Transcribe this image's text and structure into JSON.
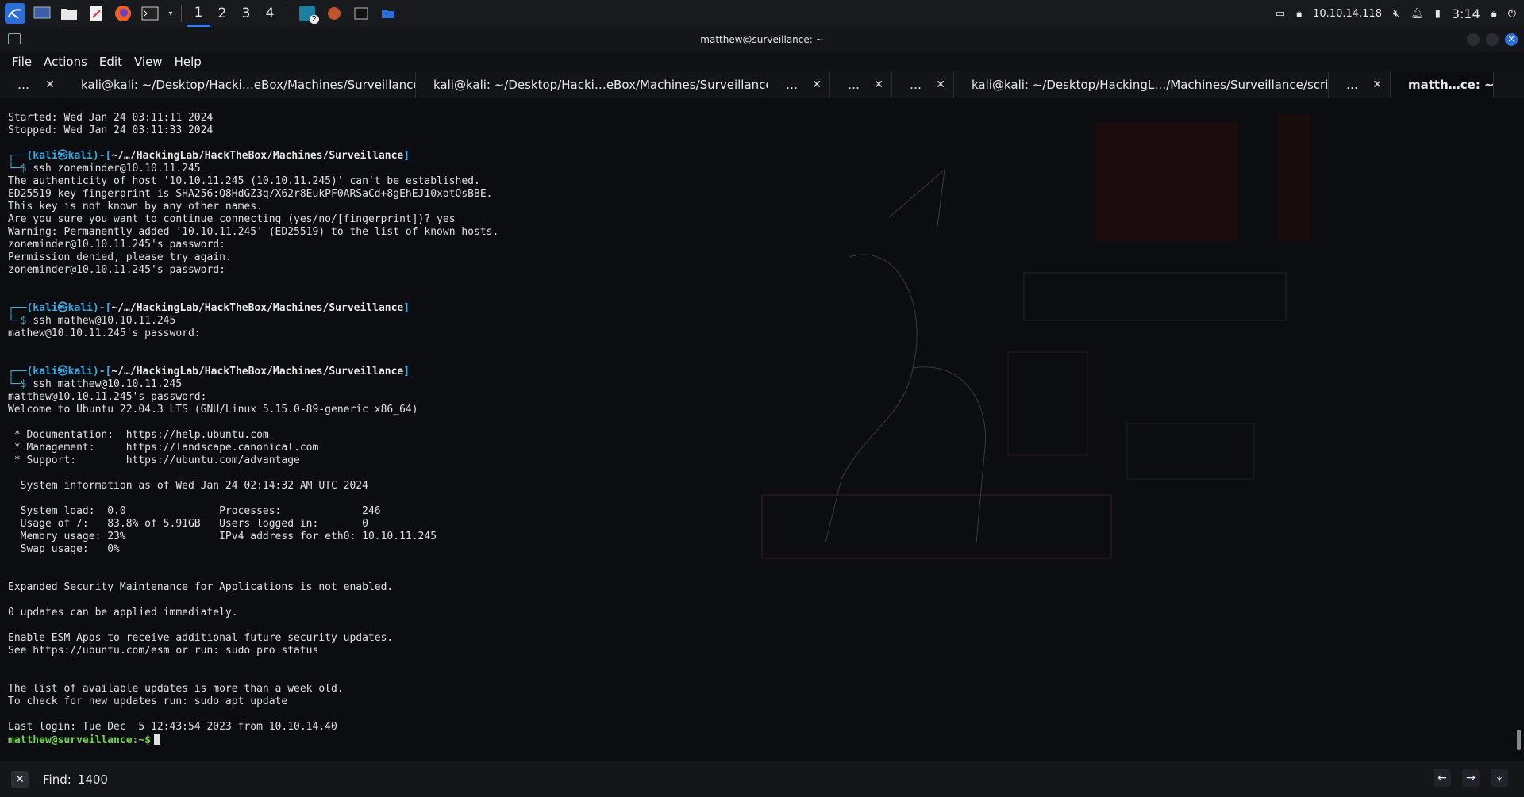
{
  "taskbar": {
    "workspaces": [
      "1",
      "2",
      "3",
      "4"
    ],
    "active_workspace": "1",
    "badge": "2",
    "tray": {
      "ip": "10.10.14.118",
      "time": "3:14"
    }
  },
  "window": {
    "title": "matthew@surveillance: ~"
  },
  "menu": [
    "File",
    "Actions",
    "Edit",
    "View",
    "Help"
  ],
  "tabs": [
    {
      "label": "…",
      "w": 80
    },
    {
      "label": "kali@kali: ~/Desktop/Hacki…eBox/Machines/Surveillance",
      "w": 444
    },
    {
      "label": "kali@kali: ~/Desktop/Hacki…eBox/Machines/Surveillance",
      "w": 444
    },
    {
      "label": "…",
      "w": 78
    },
    {
      "label": "…",
      "w": 78
    },
    {
      "label": "…",
      "w": 78
    },
    {
      "label": "kali@kali: ~/Desktop/HackingL…/Machines/Surveillance/script",
      "w": 472
    },
    {
      "label": "…",
      "w": 78
    },
    {
      "label": "matth…ce: ~",
      "w": 130,
      "active": true
    }
  ],
  "terminal": {
    "lines": [
      {
        "t": "Started: Wed Jan 24 03:11:11 2024"
      },
      {
        "t": "Stopped: Wed Jan 24 03:11:33 2024"
      },
      {
        "t": ""
      },
      {
        "k": "p1",
        "t": "┌──(kali㉿kali)-[",
        "path": "~/…/HackingLab/HackTheBox/Machines/Surveillance",
        "end": "]"
      },
      {
        "k": "p2",
        "t": "└─$ ",
        "cmd": "ssh zoneminder@10.10.11.245"
      },
      {
        "t": "The authenticity of host '10.10.11.245 (10.10.11.245)' can't be established."
      },
      {
        "t": "ED25519 key fingerprint is SHA256:Q8HdGZ3q/X62r8EukPF0ARSaCd+8gEhEJ10xotOsBBE."
      },
      {
        "t": "This key is not known by any other names."
      },
      {
        "t": "Are you sure you want to continue connecting (yes/no/[fingerprint])? yes"
      },
      {
        "t": "Warning: Permanently added '10.10.11.245' (ED25519) to the list of known hosts."
      },
      {
        "t": "zoneminder@10.10.11.245's password:"
      },
      {
        "t": "Permission denied, please try again."
      },
      {
        "t": "zoneminder@10.10.11.245's password:"
      },
      {
        "t": ""
      },
      {
        "t": ""
      },
      {
        "k": "p1",
        "t": "┌──(kali㉿kali)-[",
        "path": "~/…/HackingLab/HackTheBox/Machines/Surveillance",
        "end": "]"
      },
      {
        "k": "p2",
        "t": "└─$ ",
        "cmd": "ssh mathew@10.10.11.245"
      },
      {
        "t": "mathew@10.10.11.245's password:"
      },
      {
        "t": ""
      },
      {
        "t": ""
      },
      {
        "k": "p1",
        "t": "┌──(kali㉿kali)-[",
        "path": "~/…/HackingLab/HackTheBox/Machines/Surveillance",
        "end": "]"
      },
      {
        "k": "p2",
        "t": "└─$ ",
        "cmd": "ssh matthew@10.10.11.245"
      },
      {
        "t": "matthew@10.10.11.245's password:"
      },
      {
        "t": "Welcome to Ubuntu 22.04.3 LTS (GNU/Linux 5.15.0-89-generic x86_64)"
      },
      {
        "t": ""
      },
      {
        "t": " * Documentation:  https://help.ubuntu.com"
      },
      {
        "t": " * Management:     https://landscape.canonical.com"
      },
      {
        "t": " * Support:        https://ubuntu.com/advantage"
      },
      {
        "t": ""
      },
      {
        "t": "  System information as of Wed Jan 24 02:14:32 AM UTC 2024"
      },
      {
        "t": ""
      },
      {
        "t": "  System load:  0.0               Processes:             246"
      },
      {
        "t": "  Usage of /:   83.8% of 5.91GB   Users logged in:       0"
      },
      {
        "t": "  Memory usage: 23%               IPv4 address for eth0: 10.10.11.245"
      },
      {
        "t": "  Swap usage:   0%"
      },
      {
        "t": ""
      },
      {
        "t": ""
      },
      {
        "t": "Expanded Security Maintenance for Applications is not enabled."
      },
      {
        "t": ""
      },
      {
        "t": "0 updates can be applied immediately."
      },
      {
        "t": ""
      },
      {
        "t": "Enable ESM Apps to receive additional future security updates."
      },
      {
        "t": "See https://ubuntu.com/esm or run: sudo pro status"
      },
      {
        "t": ""
      },
      {
        "t": ""
      },
      {
        "t": "The list of available updates is more than a week old."
      },
      {
        "t": "To check for new updates run: sudo apt update"
      },
      {
        "t": ""
      },
      {
        "t": "Last login: Tue Dec  5 12:43:54 2023 from 10.10.14.40"
      },
      {
        "k": "prompt",
        "t": "matthew@surveillance:~$"
      }
    ]
  },
  "findbar": {
    "label": "Find:",
    "value": "1400"
  }
}
